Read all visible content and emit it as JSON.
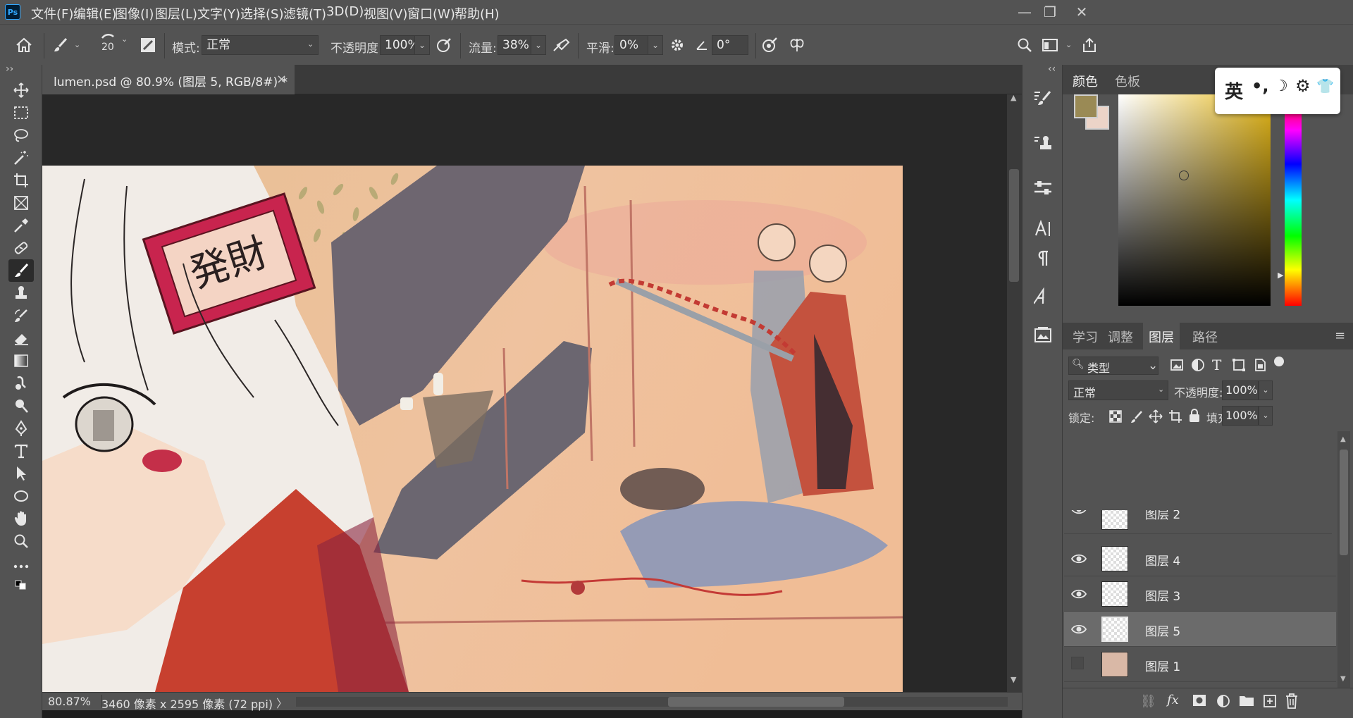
{
  "app": {
    "logo": "Ps"
  },
  "menu": [
    "文件(F)",
    "编辑(E)",
    "图像(I)",
    "图层(L)",
    "文字(Y)",
    "选择(S)",
    "滤镜(T)",
    "3D(D)",
    "视图(V)",
    "窗口(W)",
    "帮助(H)"
  ],
  "window_controls": {
    "minimize": "—",
    "restore": "❐",
    "close": "✕"
  },
  "options": {
    "brush_size": "20",
    "mode_label": "模式:",
    "mode_value": "正常",
    "opacity_label": "不透明度:",
    "opacity_value": "100%",
    "flow_label": "流量:",
    "flow_value": "38%",
    "smoothing_label": "平滑:",
    "smoothing_value": "0%",
    "angle_value": "0°"
  },
  "document": {
    "tab_title": "lumen.psd @ 80.9% (图层 5, RGB/8#) *",
    "tab_close": "×",
    "status_zoom": "80.87%",
    "status_info": "3460 像素 x 2595 像素 (72 ppi)",
    "status_arrow": "〉",
    "canvas_text": "発財"
  },
  "collapse_left": "››",
  "collapse_right": "‹‹",
  "color_panel": {
    "tabs": [
      "颜色",
      "色板"
    ],
    "foreground": "#9a8a55",
    "background": "#ecd4c8"
  },
  "ime_bar": {
    "lang": "英",
    "punct": "•,",
    "moon": "☽",
    "gear": "⚙",
    "shirt": "👕"
  },
  "layers_panel": {
    "tabs": [
      "学习",
      "调整",
      "图层",
      "路径"
    ],
    "filter_label": "类型",
    "blend_mode": "正常",
    "opacity_label": "不透明度:",
    "opacity_value": "100%",
    "lock_label": "锁定:",
    "fill_label": "填充:",
    "fill_value": "100%",
    "partial_layer": "图层 2",
    "layers": [
      {
        "name": "图层 4",
        "visible": true,
        "selected": false
      },
      {
        "name": "图层 3",
        "visible": true,
        "selected": false
      },
      {
        "name": "图层 5",
        "visible": true,
        "selected": true
      },
      {
        "name": "图层 1",
        "visible": false,
        "selected": false
      }
    ]
  }
}
